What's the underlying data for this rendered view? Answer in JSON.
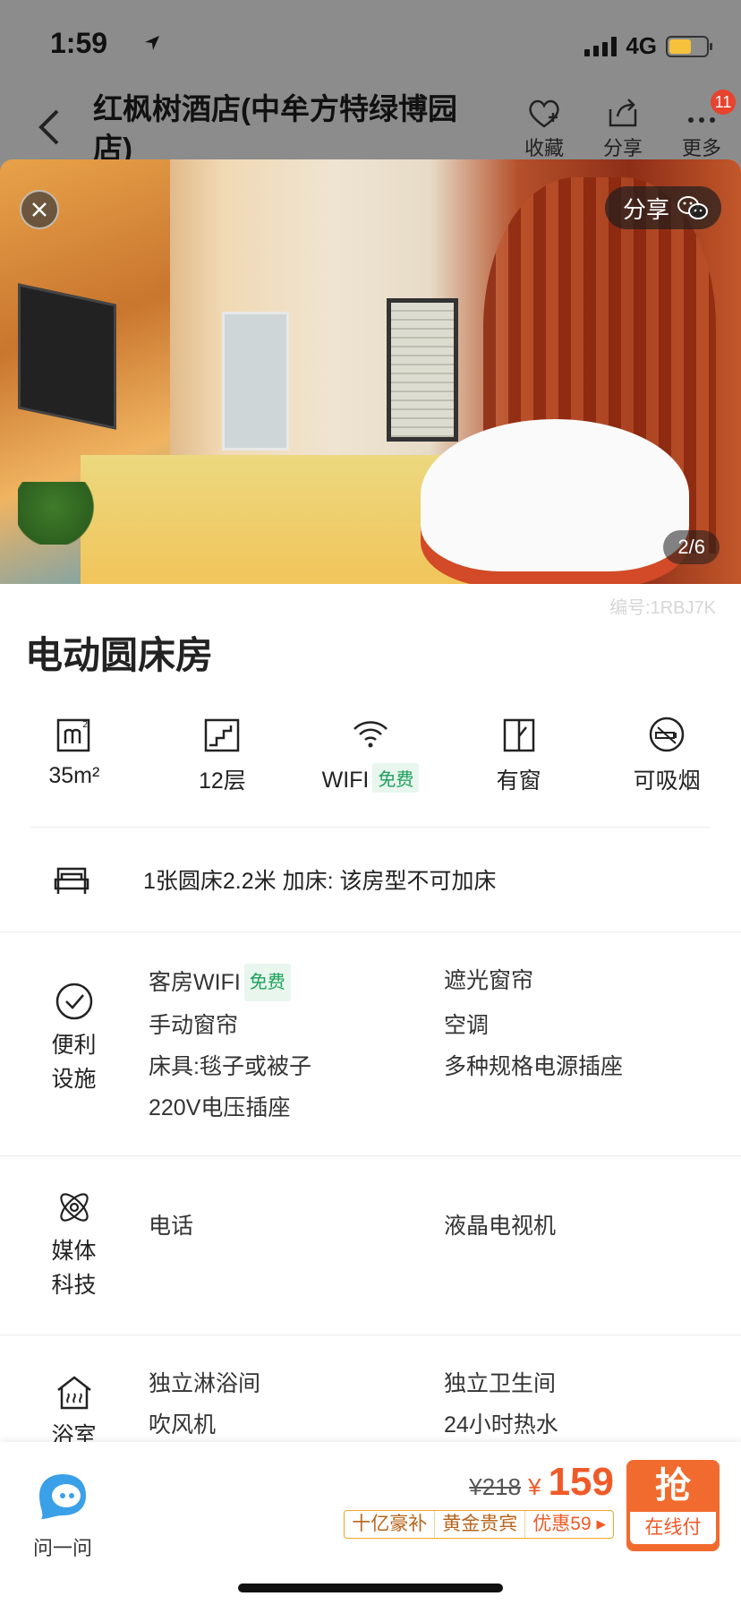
{
  "status": {
    "time": "1:59",
    "network": "4G"
  },
  "nav": {
    "title": "红枫树酒店(中牟方特绿博园店)",
    "favorite": "收藏",
    "share": "分享",
    "more": "更多",
    "badge": "11"
  },
  "photo": {
    "share_label": "分享",
    "counter": "2/6"
  },
  "room": {
    "code": "编号:1RBJ7K",
    "title": "电动圆床房",
    "features": [
      {
        "icon": "area-icon",
        "label": "35m²"
      },
      {
        "icon": "floor-icon",
        "label": "12层"
      },
      {
        "icon": "wifi-icon",
        "label": "WIFI",
        "tag": "免费"
      },
      {
        "icon": "window-icon",
        "label": "有窗"
      },
      {
        "icon": "smoking-icon",
        "label": "可吸烟"
      }
    ],
    "bed": "1张圆床2.2米  加床: 该房型不可加床"
  },
  "facilities": {
    "title": "便利设施",
    "free_tag": "免费",
    "items": [
      "客房WIFI",
      "遮光窗帘",
      "手动窗帘",
      "空调",
      "床具:毯子或被子",
      "多种规格电源插座",
      "220V电压插座"
    ]
  },
  "media": {
    "title": "媒体科技",
    "items": [
      "电话",
      "液晶电视机"
    ]
  },
  "bath": {
    "title": "浴室",
    "items": [
      "独立淋浴间",
      "独立卫生间",
      "吹风机",
      "24小时热水"
    ]
  },
  "bottom": {
    "ask": "问一问",
    "old_price": "¥218",
    "currency": "¥",
    "price": "159",
    "promo": [
      "十亿豪补",
      "黄金贵宾",
      "优惠59 ▸"
    ],
    "buy": "抢",
    "buy_sub": "在线付"
  },
  "colors": {
    "accent": "#f05a28",
    "free_green": "#1ea05a"
  }
}
